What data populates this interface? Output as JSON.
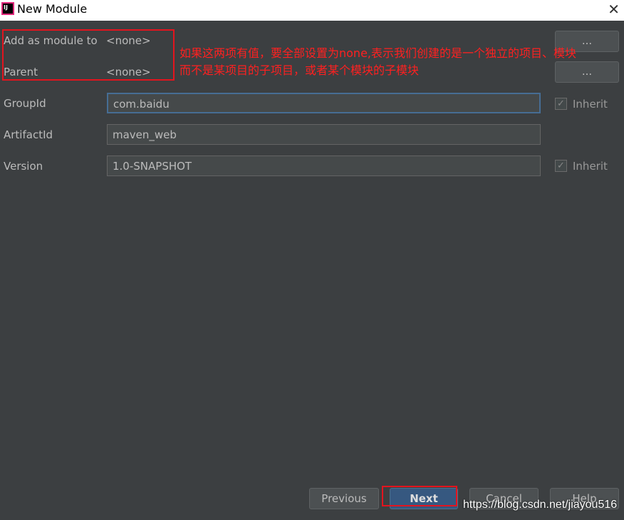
{
  "window": {
    "title": "New Module",
    "app_icon": "IJ"
  },
  "form": {
    "add_as_module_label": "Add as module to",
    "add_as_module_value": "<none>",
    "parent_label": "Parent",
    "parent_value": "<none>",
    "browse_label": "...",
    "groupid_label": "GroupId",
    "groupid_value": "com.baidu",
    "artifactid_label": "ArtifactId",
    "artifactid_value": "maven_web",
    "version_label": "Version",
    "version_value": "1.0-SNAPSHOT",
    "inherit_label": "Inherit",
    "groupid_inherit": true,
    "version_inherit": true
  },
  "annotation": {
    "line1": "如果这两项有值，要全部设置为none,表示我们创建的是一个独立的项目、模块",
    "line2": "而不是某项目的子项目，或者某个模块的子模块",
    "color": "#ff2020"
  },
  "buttons": {
    "previous": "Previous",
    "next": "Next",
    "cancel": "Cancel",
    "help": "Help"
  },
  "watermark": "https://blog.csdn.net/jiayou516"
}
